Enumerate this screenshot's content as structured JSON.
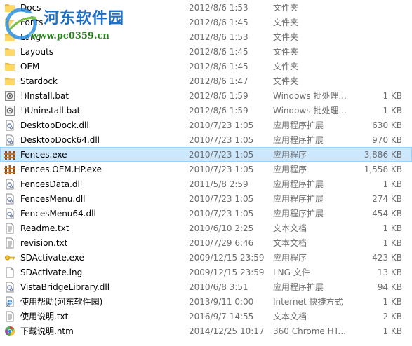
{
  "watermark": {
    "title": "河东软件园",
    "url": "www.pc0359.cn"
  },
  "files": [
    {
      "name": "Docs",
      "date": "2012/8/6 1:53",
      "type": "文件夹",
      "size": "",
      "icon": "folder-icon",
      "selected": false
    },
    {
      "name": "Fonts",
      "date": "2012/8/6 1:45",
      "type": "文件夹",
      "size": "",
      "icon": "folder-icon",
      "selected": false
    },
    {
      "name": "Lang",
      "date": "2012/8/6 1:53",
      "type": "文件夹",
      "size": "",
      "icon": "folder-icon",
      "selected": false
    },
    {
      "name": "Layouts",
      "date": "2012/8/6 1:45",
      "type": "文件夹",
      "size": "",
      "icon": "folder-icon",
      "selected": false
    },
    {
      "name": "OEM",
      "date": "2012/8/6 1:45",
      "type": "文件夹",
      "size": "",
      "icon": "folder-icon",
      "selected": false
    },
    {
      "name": "Stardock",
      "date": "2012/8/6 1:47",
      "type": "文件夹",
      "size": "",
      "icon": "folder-icon",
      "selected": false
    },
    {
      "name": "!)Install.bat",
      "date": "2012/8/6 1:59",
      "type": "Windows 批处理...",
      "size": "1 KB",
      "icon": "batch-file-icon",
      "selected": false
    },
    {
      "name": "!)Uninstall.bat",
      "date": "2012/8/6 1:59",
      "type": "Windows 批处理...",
      "size": "1 KB",
      "icon": "batch-file-icon",
      "selected": false
    },
    {
      "name": "DesktopDock.dll",
      "date": "2010/7/23 1:05",
      "type": "应用程序扩展",
      "size": "630 KB",
      "icon": "dll-file-icon",
      "selected": false
    },
    {
      "name": "DesktopDock64.dll",
      "date": "2010/7/23 1:05",
      "type": "应用程序扩展",
      "size": "970 KB",
      "icon": "dll-file-icon",
      "selected": false
    },
    {
      "name": "Fences.exe",
      "date": "2010/7/23 1:05",
      "type": "应用程序",
      "size": "3,886 KB",
      "icon": "fences-app-icon",
      "selected": true
    },
    {
      "name": "Fences.OEM.HP.exe",
      "date": "2010/7/23 1:05",
      "type": "应用程序",
      "size": "1,558 KB",
      "icon": "fences-app-icon",
      "selected": false
    },
    {
      "name": "FencesData.dll",
      "date": "2011/5/8 2:59",
      "type": "应用程序扩展",
      "size": "1 KB",
      "icon": "dll-file-icon",
      "selected": false
    },
    {
      "name": "FencesMenu.dll",
      "date": "2010/7/23 1:05",
      "type": "应用程序扩展",
      "size": "274 KB",
      "icon": "dll-file-icon",
      "selected": false
    },
    {
      "name": "FencesMenu64.dll",
      "date": "2010/7/23 1:05",
      "type": "应用程序扩展",
      "size": "454 KB",
      "icon": "dll-file-icon",
      "selected": false
    },
    {
      "name": "Readme.txt",
      "date": "2010/6/10 2:25",
      "type": "文本文档",
      "size": "1 KB",
      "icon": "text-file-icon",
      "selected": false
    },
    {
      "name": "revision.txt",
      "date": "2010/7/29 6:46",
      "type": "文本文档",
      "size": "1 KB",
      "icon": "text-file-icon",
      "selected": false
    },
    {
      "name": "SDActivate.exe",
      "date": "2009/12/15 23:59",
      "type": "应用程序",
      "size": "423 KB",
      "icon": "key-app-icon",
      "selected": false
    },
    {
      "name": "SDActivate.lng",
      "date": "2009/12/15 23:59",
      "type": "LNG 文件",
      "size": "13 KB",
      "icon": "blank-file-icon",
      "selected": false
    },
    {
      "name": "VistaBridgeLibrary.dll",
      "date": "2010/6/8 3:51",
      "type": "应用程序扩展",
      "size": "94 KB",
      "icon": "dll-file-icon",
      "selected": false
    },
    {
      "name": "使用帮助(河东软件园)",
      "date": "2013/9/11 0:00",
      "type": "Internet 快捷方式",
      "size": "1 KB",
      "icon": "internet-shortcut-icon",
      "selected": false
    },
    {
      "name": "使用说明.txt",
      "date": "2016/9/7 14:55",
      "type": "文本文档",
      "size": "2 KB",
      "icon": "text-file-icon",
      "selected": false
    },
    {
      "name": "下载说明.htm",
      "date": "2014/12/25 10:17",
      "type": "360 Chrome HT...",
      "size": "1 KB",
      "icon": "chrome-html-icon",
      "selected": false
    }
  ]
}
